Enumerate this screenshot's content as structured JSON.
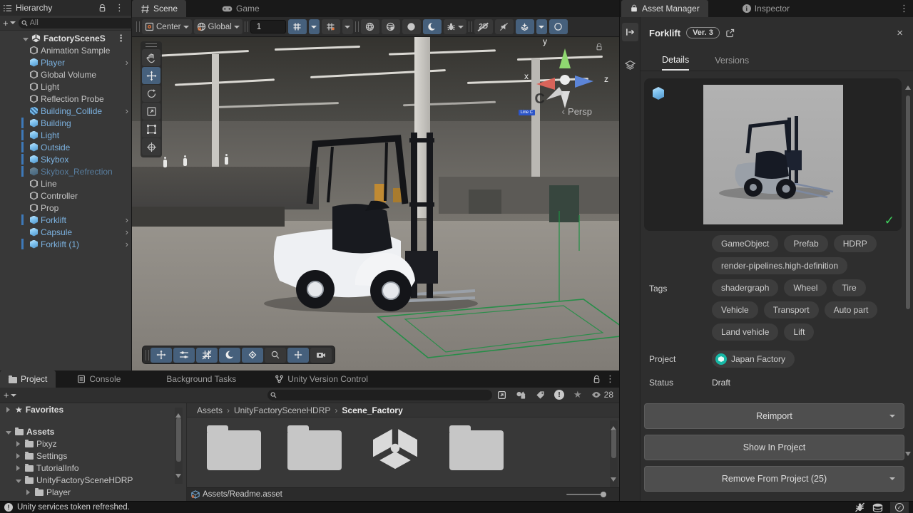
{
  "hierarchy": {
    "title": "Hierarchy",
    "search_placeholder": "All",
    "root": "FactorySceneS",
    "items": [
      {
        "label": "Animation Sample",
        "color": "gray",
        "bar": false,
        "expander": true,
        "child_arrow": false
      },
      {
        "label": "Player",
        "color": "blue",
        "bar": false,
        "expander": true,
        "child_arrow": true
      },
      {
        "label": "Global Volume",
        "color": "gray",
        "bar": false,
        "expander": false,
        "child_arrow": false
      },
      {
        "label": "Light",
        "color": "gray",
        "bar": false,
        "expander": true,
        "child_arrow": false
      },
      {
        "label": "Reflection Probe",
        "color": "gray",
        "bar": false,
        "expander": true,
        "child_arrow": false
      },
      {
        "label": "Building_Collide",
        "color": "blue",
        "bar": false,
        "expander": false,
        "child_arrow": true
      },
      {
        "label": "Building",
        "color": "blue",
        "bar": true,
        "expander": true,
        "child_arrow": false
      },
      {
        "label": "Light",
        "color": "blue",
        "bar": true,
        "expander": true,
        "child_arrow": false
      },
      {
        "label": "Outside",
        "color": "blue",
        "bar": true,
        "expander": false,
        "child_arrow": false
      },
      {
        "label": "Skybox",
        "color": "blue",
        "bar": true,
        "expander": false,
        "child_arrow": false
      },
      {
        "label": "Skybox_Refrection",
        "color": "dim",
        "bar": true,
        "expander": false,
        "child_arrow": false
      },
      {
        "label": "Line",
        "color": "gray",
        "bar": false,
        "expander": true,
        "child_arrow": false
      },
      {
        "label": "Controller",
        "color": "gray",
        "bar": false,
        "expander": true,
        "child_arrow": false
      },
      {
        "label": "Prop",
        "color": "gray",
        "bar": false,
        "expander": true,
        "child_arrow": false
      },
      {
        "label": "Forklift",
        "color": "blue",
        "bar": true,
        "expander": true,
        "child_arrow": true
      },
      {
        "label": "Capsule",
        "color": "blue",
        "bar": false,
        "expander": false,
        "child_arrow": true
      },
      {
        "label": "Forklift (1)",
        "color": "blue",
        "bar": true,
        "expander": true,
        "child_arrow": true
      }
    ]
  },
  "scene": {
    "tabs": {
      "scene": "Scene",
      "game": "Game"
    },
    "toolbar": {
      "pivot": "Center",
      "orientation": "Global",
      "grid_size": "1"
    },
    "gizmo": {
      "x_label": "x",
      "y_label": "y",
      "z_label": "z",
      "mode": "Persp"
    },
    "viewport": {
      "pillar_letter": "C",
      "sign_text": "Line C"
    }
  },
  "asset_manager": {
    "tab": "Asset Manager",
    "inspector_tab": "Inspector",
    "title": "Forklift",
    "version_badge": "Ver. 3",
    "tabs": {
      "details": "Details",
      "versions": "Versions"
    },
    "tags_label": "Tags",
    "tags": [
      "GameObject",
      "Prefab",
      "HDRP",
      "render-pipelines.high-definition",
      "shadergraph",
      "Wheel",
      "Tire",
      "Vehicle",
      "Transport",
      "Auto part",
      "Land vehicle",
      "Lift"
    ],
    "project_label": "Project",
    "project_value": "Japan Factory",
    "status_label": "Status",
    "status_value": "Draft",
    "buttons": {
      "reimport": "Reimport",
      "show_in_project": "Show In Project",
      "remove": "Remove From Project (25)"
    }
  },
  "project": {
    "tabs": {
      "project": "Project",
      "console": "Console",
      "background_tasks": "Background Tasks",
      "version_control": "Unity Version Control"
    },
    "favorites": "Favorites",
    "tree": [
      "Assets",
      "Pixyz",
      "Settings",
      "TutorialInfo",
      "UnityFactorySceneHDRP",
      "Player"
    ],
    "breadcrumb": [
      "Assets",
      "UnityFactorySceneHDRP",
      "Scene_Factory"
    ],
    "selection_path": "Assets/Readme.asset",
    "visible_count": "28"
  },
  "status_bar": {
    "message": "Unity services token refreshed."
  },
  "colors": {
    "prefab_blue": "#7cb2e0",
    "toggle_blue": "#46607c",
    "green_check": "#3fd35e",
    "chip_teal": "#17b8a6",
    "bar_blue": "#3e79b9",
    "outline_green": "#1d8f43"
  }
}
